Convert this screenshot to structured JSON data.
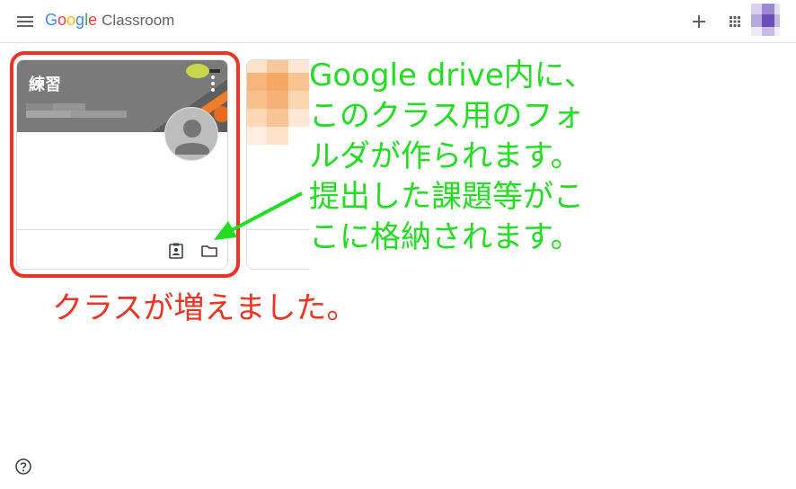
{
  "topbar": {
    "brand_google": [
      "G",
      "o",
      "o",
      "g",
      "l",
      "e"
    ],
    "brand_colors": [
      "#4285f4",
      "#ea4335",
      "#fbbc05",
      "#4285f4",
      "#34a853",
      "#ea4335"
    ],
    "product_name": "Classroom",
    "icons": {
      "menu": "hamburger-menu-icon",
      "create": "plus-icon",
      "apps": "google-apps-icon",
      "account": "account-avatar"
    }
  },
  "class_card": {
    "title": "練習",
    "header_color": "#7a7a7a",
    "icons": {
      "more": "more-vert-icon",
      "avatar": "teacher-avatar",
      "assignments": "assignment-ind-icon",
      "drive_folder": "folder-icon"
    }
  },
  "annotations": {
    "drive_note": "Google drive内に、\nこのクラス用のフォ\nルダが作られます。\n提出した課題等がこ\nこに格納されます。",
    "class_added_note": "クラスが増えました。",
    "colors": {
      "drive_note": "#22dd22",
      "class_added_note": "#ee3322",
      "highlight": "#ee3322"
    }
  },
  "footer": {
    "help_icon": "help-icon"
  }
}
